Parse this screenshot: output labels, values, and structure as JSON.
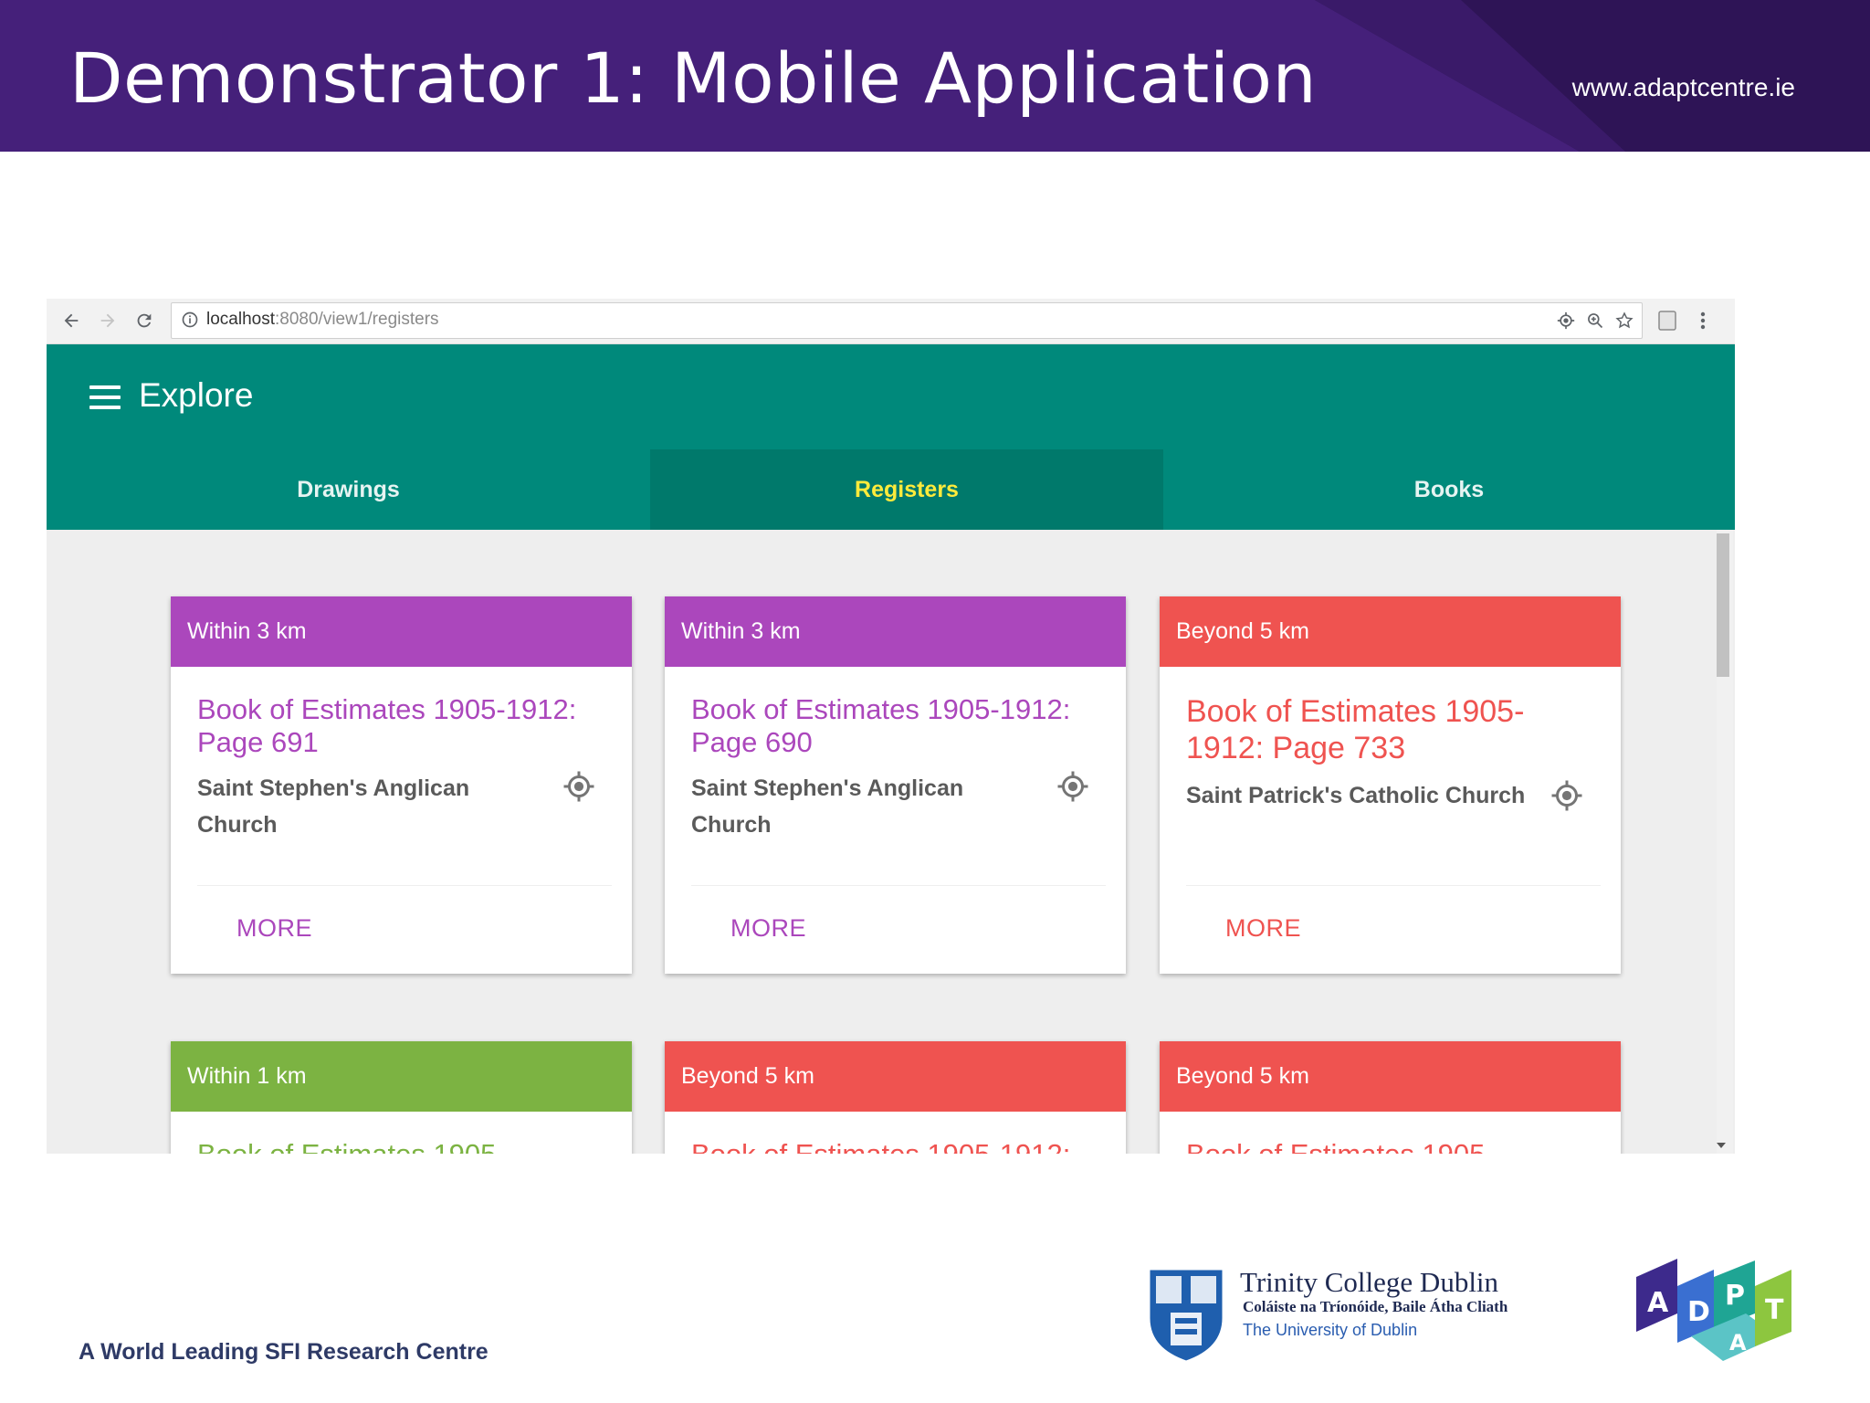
{
  "slide": {
    "title": "Demonstrator 1: Mobile Application",
    "url": "www.adaptcentre.ie",
    "tagline": "A World Leading SFI Research Centre",
    "colors": {
      "header": "#45207a",
      "accent": "#00897b"
    }
  },
  "browser": {
    "url_host": "localhost",
    "url_path": ":8080/view1/registers",
    "icons": [
      "back-arrow-icon",
      "forward-arrow-icon",
      "reload-icon",
      "info-icon",
      "location-icon",
      "zoom-icon",
      "star-icon",
      "extension-icon",
      "more-vert-icon"
    ]
  },
  "app": {
    "title": "Explore",
    "tabs": [
      {
        "label": "Drawings"
      },
      {
        "label": "Registers"
      },
      {
        "label": "Books"
      }
    ],
    "active_tab": "Registers",
    "cards": [
      {
        "distance": "Within 3 km",
        "title": "Book of Estimates 1905-1912: Page 691",
        "location": "Saint Stephen's Anglican Church",
        "action": "MORE",
        "color": "#ab47bc"
      },
      {
        "distance": "Within 3 km",
        "title": "Book of Estimates 1905-1912: Page 690",
        "location": "Saint Stephen's Anglican Church",
        "action": "MORE",
        "color": "#ab47bc"
      },
      {
        "distance": "Beyond 5 km",
        "title": "Book of Estimates 1905-1912: Page 733",
        "location": "Saint Patrick's Catholic Church",
        "action": "MORE",
        "color": "#ef5350"
      },
      {
        "distance": "Within 1 km",
        "title": "Book of Estimates 1905",
        "color": "#7cb342"
      },
      {
        "distance": "Beyond 5 km",
        "title": "Book of Estimates 1905-1912:",
        "color": "#ef5350"
      },
      {
        "distance": "Beyond 5 km",
        "title": "Book of Estimates 1905",
        "color": "#ef5350"
      }
    ]
  },
  "footer": {
    "tcd_name": "Trinity College Dublin",
    "tcd_irish": "Coláiste na Tríonóide, Baile Átha Cliath",
    "tcd_university": "The University of Dublin",
    "adapt_letters": [
      "A",
      "D",
      "P",
      "A",
      "T"
    ]
  }
}
